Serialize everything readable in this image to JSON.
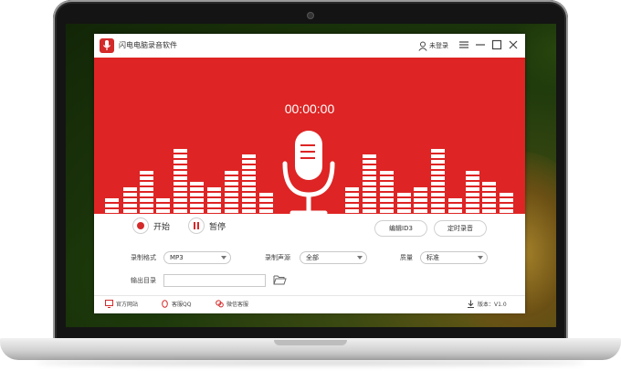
{
  "app": {
    "title": "闪电电脑录音软件",
    "login_label": "未登录"
  },
  "recorder": {
    "timer": "00:00:00",
    "start_label": "开始",
    "pause_label": "暂停",
    "edit_id3_label": "编辑ID3",
    "schedule_label": "定时录音"
  },
  "settings": {
    "format_label": "录制格式",
    "format_value": "MP3",
    "source_label": "录制声源",
    "source_value": "全部",
    "quality_label": "质量",
    "quality_value": "标准",
    "output_label": "输出目录",
    "output_value": ""
  },
  "footer": {
    "website_label": "官方网站",
    "qq_label": "客服QQ",
    "wechat_label": "微信客服",
    "version_label": "版本：V1.0"
  },
  "colors": {
    "accent": "#de2424",
    "window_bg": "#ffffff",
    "text": "#333333"
  },
  "icons": [
    "app-logo-icon",
    "user-icon",
    "menu-icon",
    "minimize-icon",
    "maximize-icon",
    "close-icon",
    "microphone-icon",
    "record-icon",
    "pause-icon",
    "folder-icon",
    "monitor-icon",
    "qq-icon",
    "wechat-icon",
    "download-icon"
  ]
}
